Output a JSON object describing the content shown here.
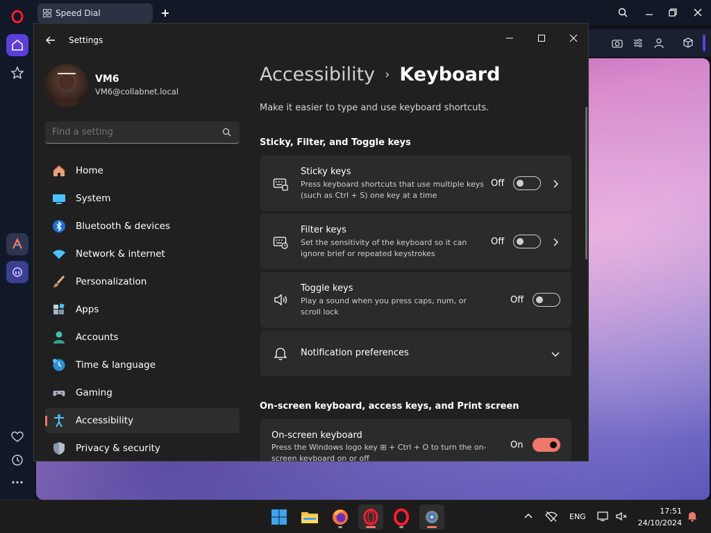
{
  "browser": {
    "tab_label": "Speed Dial",
    "new_tab": "+"
  },
  "window": {
    "title": "Settings"
  },
  "user": {
    "name": "VM6",
    "email": "VM6@collabnet.local"
  },
  "search": {
    "placeholder": "Find a setting"
  },
  "nav": {
    "items": [
      {
        "label": "Home",
        "icon": "home-icon"
      },
      {
        "label": "System",
        "icon": "system-icon"
      },
      {
        "label": "Bluetooth & devices",
        "icon": "bluetooth-icon"
      },
      {
        "label": "Network & internet",
        "icon": "wifi-icon"
      },
      {
        "label": "Personalization",
        "icon": "brush-icon"
      },
      {
        "label": "Apps",
        "icon": "apps-icon"
      },
      {
        "label": "Accounts",
        "icon": "accounts-icon"
      },
      {
        "label": "Time & language",
        "icon": "time-language-icon"
      },
      {
        "label": "Gaming",
        "icon": "gamepad-icon"
      },
      {
        "label": "Accessibility",
        "icon": "accessibility-icon"
      },
      {
        "label": "Privacy & security",
        "icon": "shield-icon"
      }
    ],
    "active": "Accessibility"
  },
  "page": {
    "breadcrumb_parent": "Accessibility",
    "breadcrumb_sep": "›",
    "breadcrumb_current": "Keyboard",
    "description": "Make it easier to type and use keyboard shortcuts."
  },
  "sections": {
    "sticky_title": "Sticky, Filter, and Toggle keys",
    "onscreen_title": "On-screen keyboard, access keys, and Print screen"
  },
  "settings": {
    "sticky": {
      "title": "Sticky keys",
      "desc": "Press keyboard shortcuts that use multiple keys (such as Ctrl + S) one key at a time",
      "state": "Off"
    },
    "filter": {
      "title": "Filter keys",
      "desc": "Set the sensitivity of the keyboard so it can ignore brief or repeated keystrokes",
      "state": "Off"
    },
    "toggle": {
      "title": "Toggle keys",
      "desc": "Play a sound when you press caps, num, or scroll lock",
      "state": "Off"
    },
    "notification": {
      "title": "Notification preferences"
    },
    "onscreen": {
      "title": "On-screen keyboard",
      "desc": "Press the Windows logo key ⊞ + Ctrl + O to turn the on-screen keyboard on or off",
      "state": "On"
    }
  },
  "taskbar": {
    "lang": "ENG",
    "time": "17:51",
    "date": "24/10/2024"
  },
  "colors": {
    "accent": "#f0786a",
    "window_bg": "#202020",
    "card_bg": "#2b2b2b"
  }
}
